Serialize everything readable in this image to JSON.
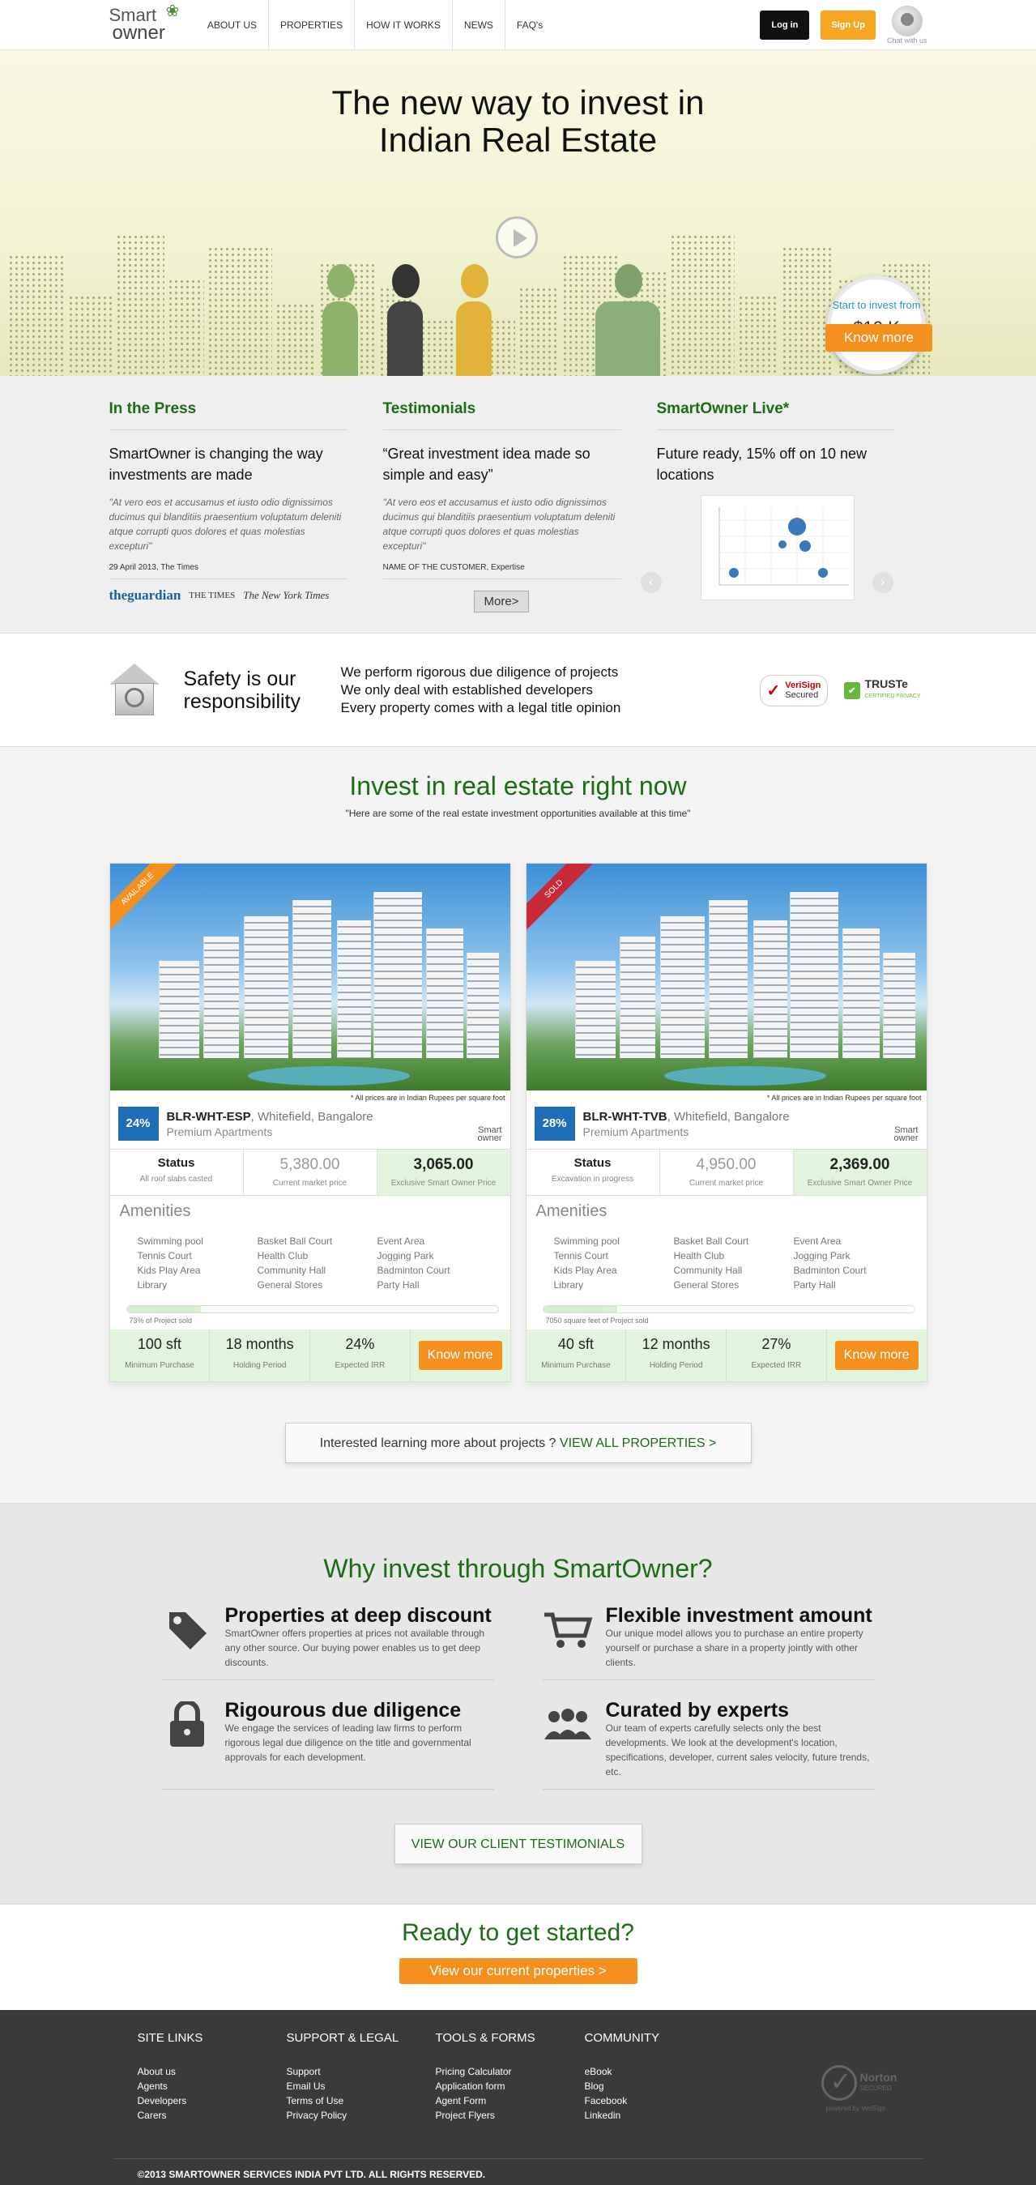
{
  "header": {
    "logo_line1": "Smart",
    "logo_line2": "owner",
    "nav": [
      "ABOUT US",
      "PROPERTIES",
      "HOW IT WORKS",
      "NEWS",
      "FAQ's"
    ],
    "login_label": "Log in",
    "signup_label": "Sign Up",
    "chat_label": "Chat with us"
  },
  "hero": {
    "title_line1": "The new way to invest in",
    "title_line2": "Indian Real Estate",
    "bubble_text": "Start to invest from",
    "bubble_value": "$10 K",
    "cta_label": "Know more"
  },
  "press": {
    "heading": "In the Press",
    "headline": "SmartOwner is changing the way investments are made",
    "quote": "\"At vero eos et accusamus et iusto odio dignissimos ducimus qui blanditiis praesentium voluptatum deleniti atque corrupti quos dolores et quas molestias excepturi\"",
    "source": "29 April 2013, The Times",
    "logos": [
      "theguardian",
      "THE TIMES",
      "The New York Times"
    ]
  },
  "testimonials": {
    "heading": "Testimonials",
    "headline": "“Great investment idea made so simple and easy”",
    "quote": "\"At vero eos et accusamus et iusto odio dignissimos ducimus qui blanditiis praesentium voluptatum deleniti atque corrupti quos dolores et quas molestias excepturi\"",
    "source": "NAME OF THE CUSTOMER, Expertise",
    "more_label": "More>"
  },
  "live": {
    "heading": "SmartOwner Live*",
    "headline": "Future ready, 15% off on 10 new locations"
  },
  "safety": {
    "title": "Safety is our responsibility",
    "points": [
      "We perform rigorous due diligence of projects",
      "We only deal with established developers",
      "Every property comes with a legal title opinion"
    ],
    "seal1_line1": "VeriSign",
    "seal1_line2": "Secured",
    "seal2_label": "TRUSTe",
    "seal2_sub": "CERTIFIED PRIVACY"
  },
  "invest": {
    "title": "Invest in real estate right now",
    "subtitle": "\"Here are some of the real estate investment opportunities available at this time\"",
    "amenities_heading": "Amenities",
    "amenities": [
      "Swimming pool",
      "Basket Ball Court",
      "Event Area",
      "Tennis Court",
      "Health Club",
      "Jogging Park",
      "Kids Play Area",
      "Community Hall",
      "Badminton Court",
      "Library",
      "General Stores",
      "Party Hall"
    ],
    "price_note": "* All prices are in Indian Rupees per square foot",
    "mini_logo_line1": "Smart",
    "mini_logo_line2": "owner",
    "status_label": "Status",
    "market_label": "Current market price",
    "exclusive_label": "Exclusive Smart Owner Price",
    "min_label": "Minimum Purchase",
    "holding_label": "Holding Period",
    "irr_label": "Expected IRR",
    "know_label": "Know more",
    "cards": [
      {
        "ribbon": "Available",
        "discount": "24%",
        "code": "BLR-WHT-ESP",
        "location": ", Whitefield, Bangalore",
        "category": "Premium Apartments",
        "status_detail": "All roof slabs casted",
        "market_price": "5,380.00",
        "exclusive_price": "3,065.00",
        "progress": 0.2,
        "progress_label": "73% of Project sold",
        "min_purchase": "100 sft",
        "holding": "18 months",
        "irr": "24%"
      },
      {
        "ribbon": "Sold",
        "discount": "28%",
        "code": "BLR-WHT-TVB",
        "location": ", Whitefield, Bangalore",
        "category": "Premium Apartments",
        "status_detail": "Excavation in progress",
        "market_price": "4,950.00",
        "exclusive_price": "2,369.00",
        "progress": 0.2,
        "progress_label": "7050 square feet of Project sold",
        "min_purchase": "40 sft",
        "holding": "12 months",
        "irr": "27%"
      }
    ],
    "view_all_prefix": "Interested learning more about projects ?",
    "view_all_link": "VIEW ALL PROPERTIES >"
  },
  "why": {
    "title": "Why invest through SmartOwner?",
    "items": [
      {
        "title": "Properties at deep discount",
        "text": "SmartOwner offers properties at prices not available through any other source. Our buying power enables us to get deep discounts."
      },
      {
        "title": "Flexible investment amount",
        "text": "Our unique model allows you to purchase an entire property yourself or purchase a share in a property jointly with other clients."
      },
      {
        "title": "Rigourous due diligence",
        "text": "We engage the services of leading law firms to perform rigorous legal due diligence on the title and governmental approvals for each development."
      },
      {
        "title": "Curated by experts",
        "text": "Our team of experts carefully selects only the best developments. We look at the development's location, specifications, developer, current sales velocity, future trends, etc."
      }
    ],
    "testimonials_btn": "VIEW OUR CLIENT TESTIMONIALS"
  },
  "ready": {
    "title": "Ready to get started?",
    "cta": "View our current properties >"
  },
  "footer": {
    "columns": [
      {
        "heading": "SITE LINKS",
        "links": [
          "About us",
          "Agents",
          "Developers",
          "Carers"
        ]
      },
      {
        "heading": "SUPPORT & LEGAL",
        "links": [
          "Support",
          "Email Us",
          "Terms of Use",
          "Privacy Policy"
        ]
      },
      {
        "heading": "TOOLS & FORMS",
        "links": [
          "Pricing Calculator",
          "Application form",
          "Agent Form",
          "Project Flyers"
        ]
      },
      {
        "heading": "COMMUNITY",
        "links": [
          "eBook",
          "Blog",
          "Facebook",
          "Linkedin"
        ]
      }
    ],
    "norton_title": "Norton",
    "norton_sub": "SECURED",
    "norton_powered": "powered by VeriSign",
    "copyright": "©2013 SMARTOWNER SERVICES INDIA PVT LTD. ALL RIGHTS RESERVED."
  },
  "colors": {
    "brand_green": "#1d6b17",
    "accent_orange": "#f5901e",
    "discount_blue": "#1e6db5",
    "sold_red": "#c92a38",
    "footer_bg": "#3a3a3a"
  },
  "icons": [
    "chat-icon",
    "play-icon",
    "safe-house-icon",
    "tag-icon",
    "cart-icon",
    "lock-icon",
    "people-icon",
    "norton-check-icon"
  ]
}
